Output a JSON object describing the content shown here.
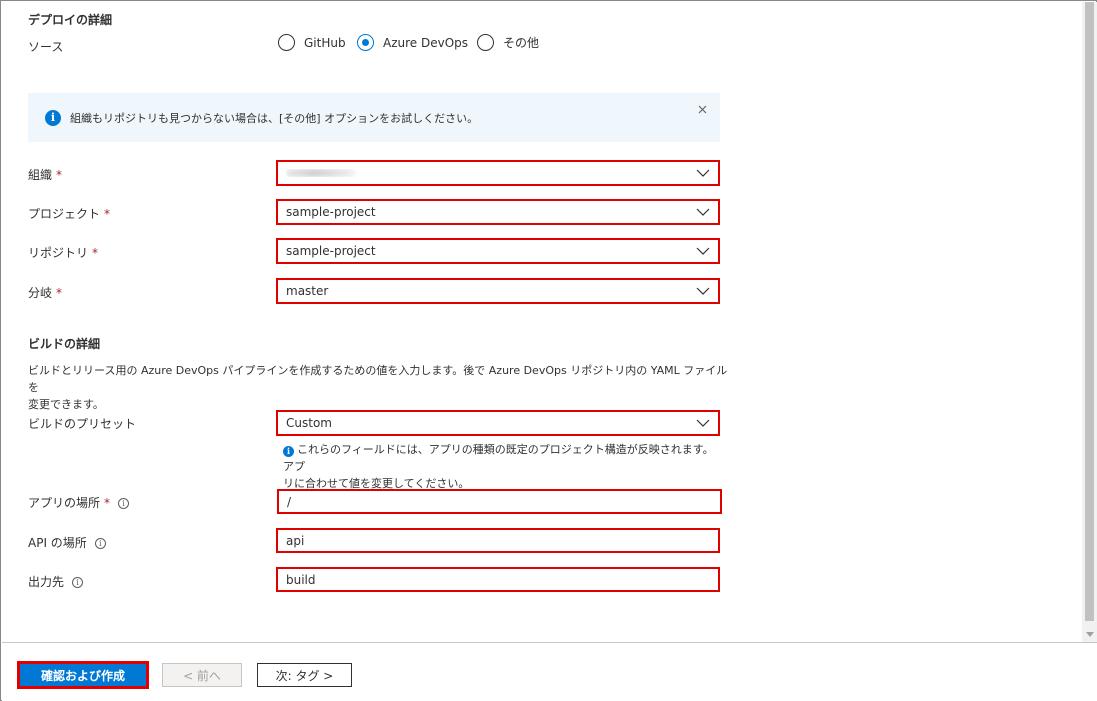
{
  "deploy": {
    "title": "デプロイの詳細",
    "source_label": "ソース",
    "source_options": [
      {
        "label": "GitHub",
        "selected": false
      },
      {
        "label": "Azure DevOps",
        "selected": true
      },
      {
        "label": "その他",
        "selected": false
      }
    ],
    "banner_text": "組織もリポジトリも見つからない場合は、[その他] オプションをお試しください。",
    "organization": {
      "label": "組織",
      "required": "*",
      "value": ""
    },
    "project": {
      "label": "プロジェクト",
      "required": "*",
      "value": "sample-project"
    },
    "repository": {
      "label": "リポジトリ",
      "required": "*",
      "value": "sample-project"
    },
    "branch": {
      "label": "分岐",
      "required": "*",
      "value": "master"
    }
  },
  "build": {
    "title": "ビルドの詳細",
    "description_line1": "ビルドとリリース用の Azure DevOps パイプラインを作成するための値を入力します。後で Azure DevOps リポジトリ内の YAML ファイルを",
    "description_line2": "変更できます。",
    "preset": {
      "label": "ビルドのプリセット",
      "value": "Custom"
    },
    "preset_help_line1": "これらのフィールドには、アプリの種類の既定のプロジェクト構造が反映されます。アプ",
    "preset_help_line2": "リに合わせて値を変更してください。",
    "app_location": {
      "label": "アプリの場所",
      "required": "*",
      "value": "/"
    },
    "api_location": {
      "label": "API の場所",
      "value": "api"
    },
    "output_location": {
      "label": "出力先",
      "value": "build"
    }
  },
  "footer": {
    "review_create": "確認および作成",
    "previous": "< 前へ",
    "next": "次: タグ >"
  },
  "colors": {
    "accent": "#0078d4",
    "highlight_border": "#e00000",
    "banner_bg": "#eff6fc",
    "required": "#a4262c"
  },
  "icons": {
    "banner": "info-icon",
    "close": "close-icon",
    "dropdown": "chevron-down-icon",
    "tooltip": "info-circle-icon"
  }
}
